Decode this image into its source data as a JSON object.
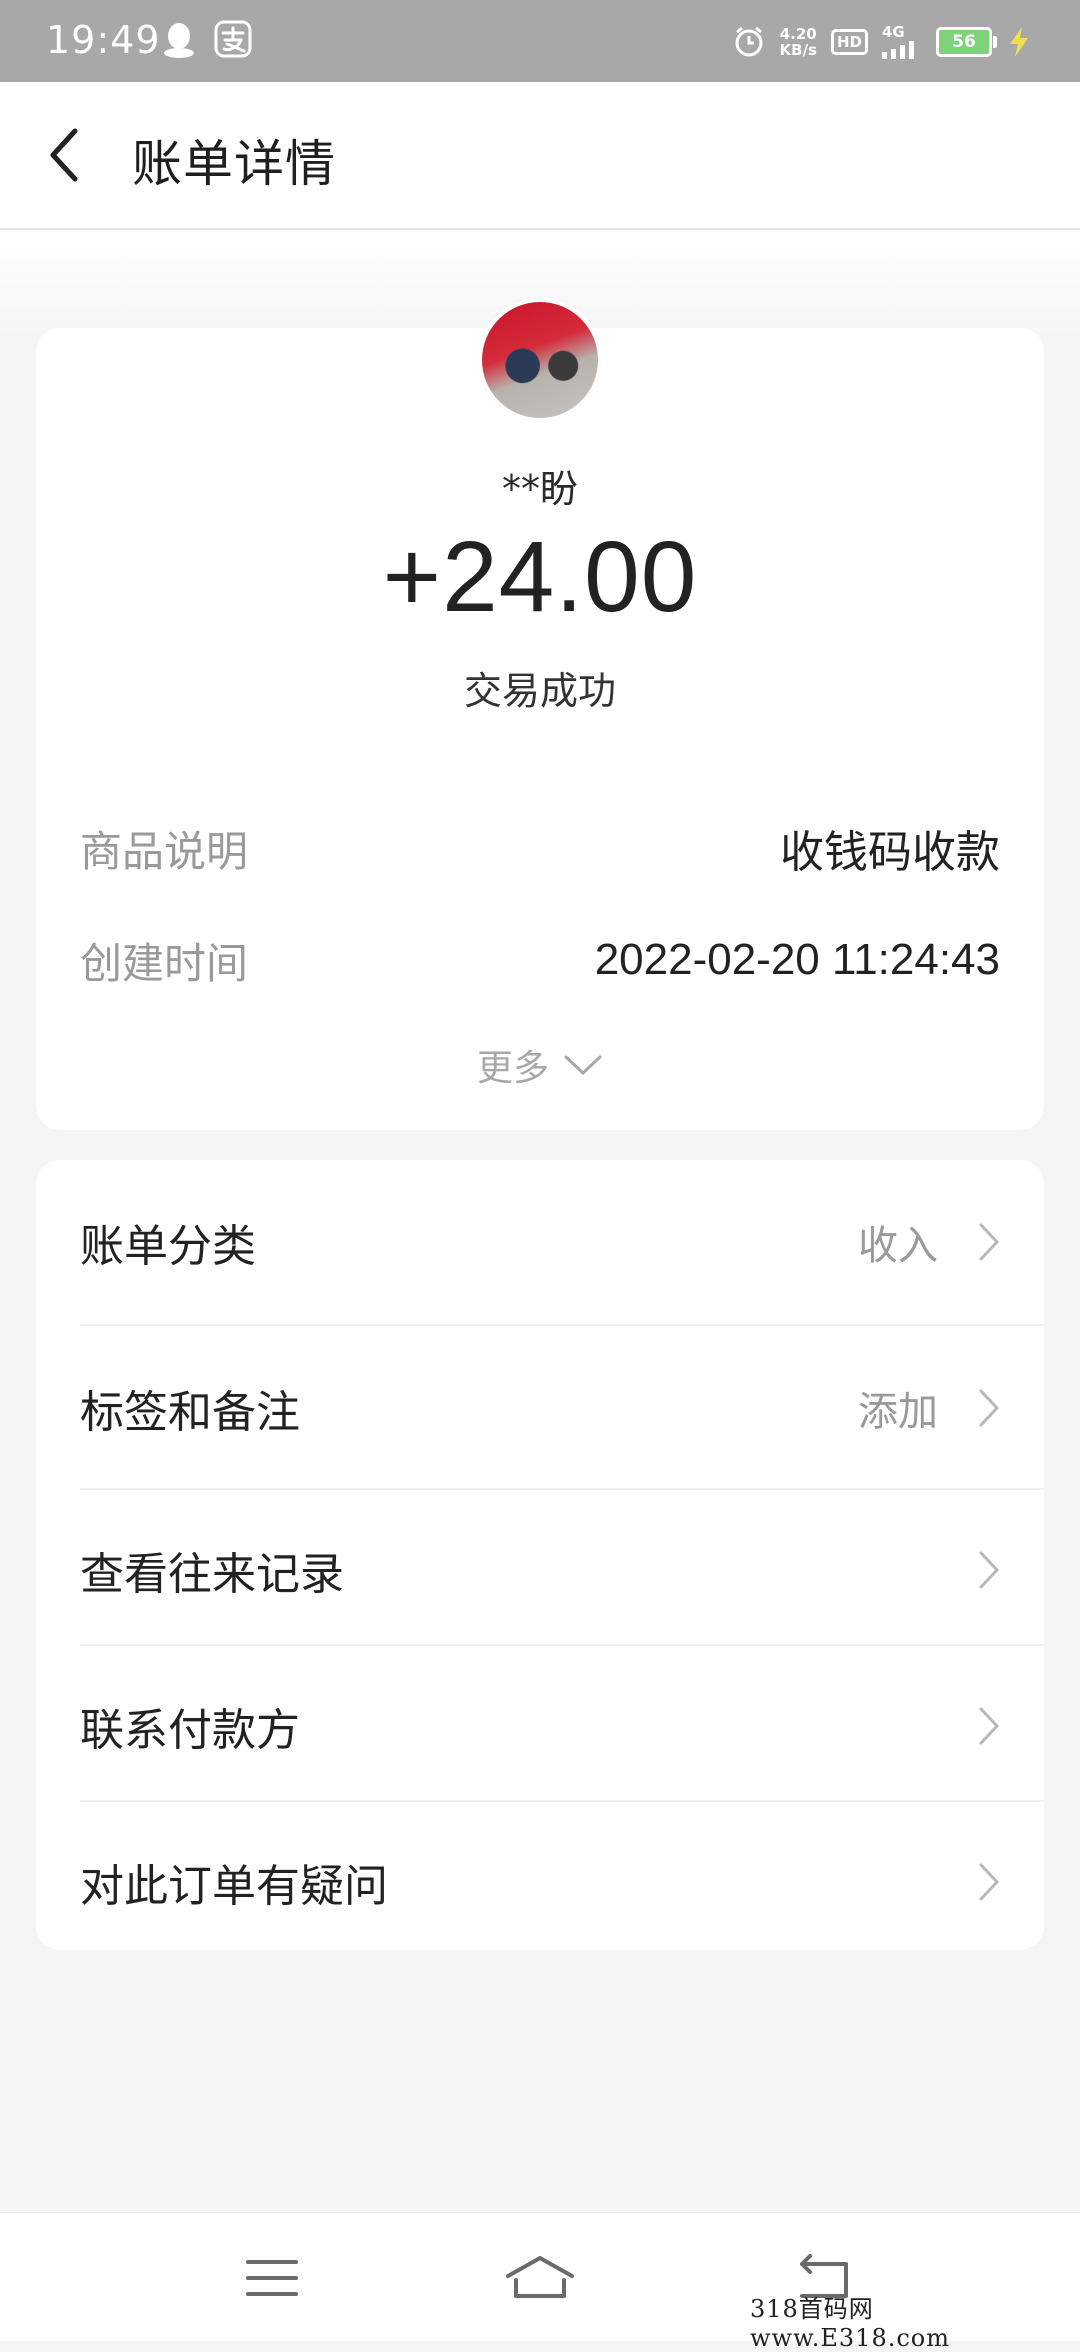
{
  "status_bar": {
    "time": "19:49",
    "net_speed_value": "4.20",
    "net_speed_unit": "KB/s",
    "hd_label": "HD",
    "signal_type": "4G",
    "battery_level": "56",
    "battery_color": "#7ed37a"
  },
  "header": {
    "title": "账单详情"
  },
  "transaction": {
    "payer_name": "**盼",
    "amount": "+24.00",
    "status": "交易成功",
    "details": [
      {
        "label": "商品说明",
        "value": "收钱码收款"
      },
      {
        "label": "创建时间",
        "value": "2022-02-20 11:24:43"
      }
    ],
    "more_label": "更多"
  },
  "actions": [
    {
      "label": "账单分类",
      "value": "收入"
    },
    {
      "label": "标签和备注",
      "value": "添加"
    },
    {
      "label": "查看往来记录",
      "value": ""
    },
    {
      "label": "联系付款方",
      "value": ""
    },
    {
      "label": "对此订单有疑问",
      "value": ""
    }
  ],
  "watermark": "318首码网 www.E318.com"
}
